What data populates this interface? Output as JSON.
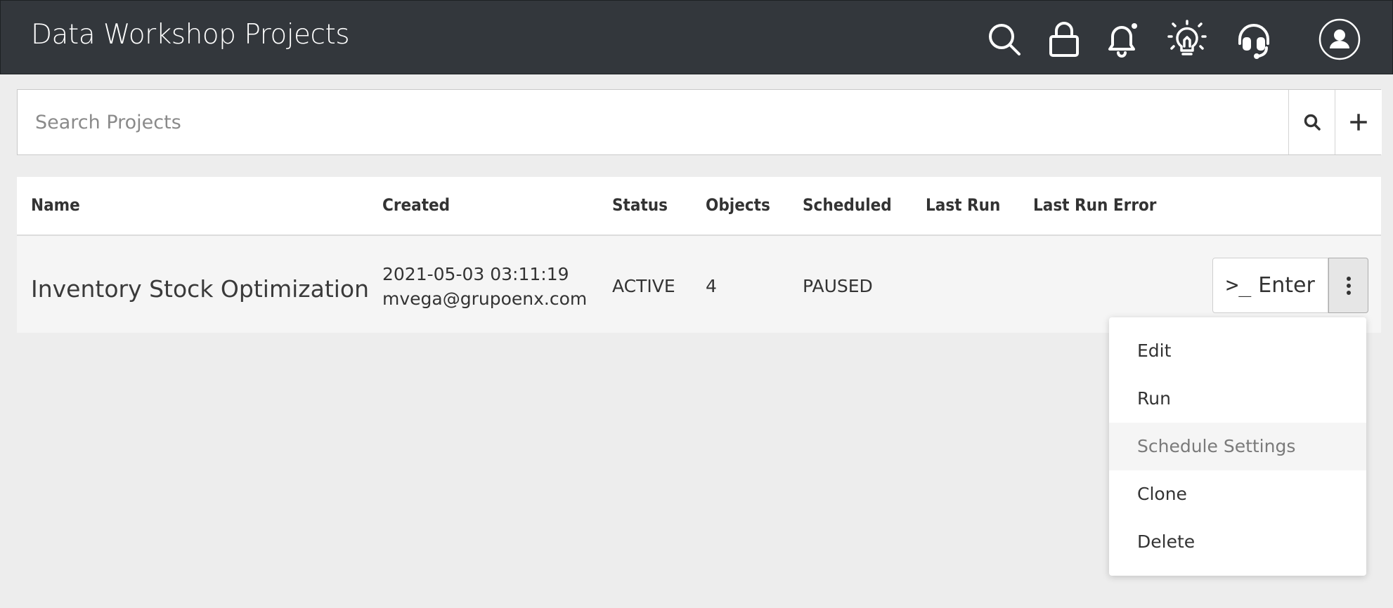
{
  "header": {
    "title": "Data Workshop Projects",
    "icons": [
      "search-icon",
      "lock-icon",
      "bell-icon",
      "lightbulb-icon",
      "headset-icon",
      "user-avatar-icon"
    ]
  },
  "search": {
    "placeholder": "Search Projects",
    "value": ""
  },
  "table": {
    "columns": [
      "Name",
      "Created",
      "Status",
      "Objects",
      "Scheduled",
      "Last Run",
      "Last Run Error"
    ],
    "rows": [
      {
        "name": "Inventory Stock Optimization",
        "created_date": "2021-05-03 03:11:19",
        "created_by": "mvega@grupoenx.com",
        "status": "ACTIVE",
        "objects": "4",
        "scheduled": "PAUSED",
        "last_run": "",
        "last_run_error": "",
        "enter_prompt": ">_",
        "enter_label": "Enter"
      }
    ]
  },
  "menu": {
    "items": [
      "Edit",
      "Run",
      "Schedule Settings",
      "Clone",
      "Delete"
    ],
    "hovered_index": 2
  },
  "colors": {
    "header_bg": "#33373c",
    "page_bg": "#ededed",
    "text": "#333333"
  }
}
